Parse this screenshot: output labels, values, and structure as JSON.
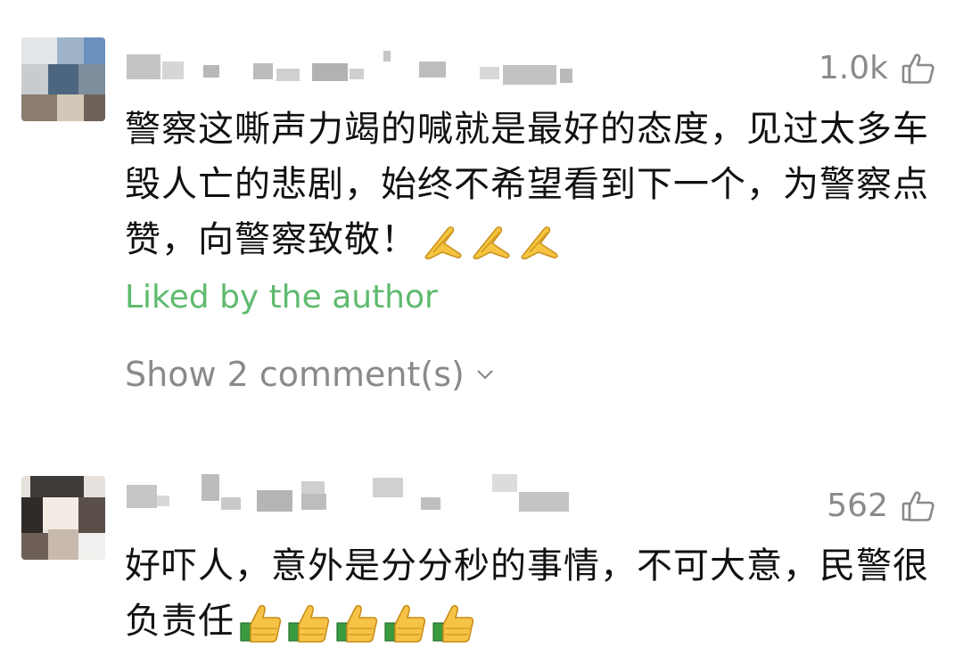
{
  "comments": [
    {
      "likes": "1.0k",
      "text": "警察这嘶声力竭的喊就是最好的态度，见过太多车毁人亡的悲剧，始终不希望看到下一个，为警察点赞，向警察致敬！",
      "emoji": [
        "pray-emoji",
        "pray-emoji",
        "pray-emoji"
      ],
      "liked_label": "Liked by the author",
      "show_replies": "Show 2 comment(s)"
    },
    {
      "likes": "562",
      "text": "好吓人，意外是分分秒的事情，不可大意，民警很负责任",
      "emoji": [
        "thumbs-up-emoji",
        "thumbs-up-emoji",
        "thumbs-up-emoji",
        "thumbs-up-emoji",
        "thumbs-up-emoji"
      ]
    }
  ],
  "colors": {
    "liked_green": "#5fba6e",
    "muted_gray": "#8a8a8a",
    "text": "#111111"
  }
}
